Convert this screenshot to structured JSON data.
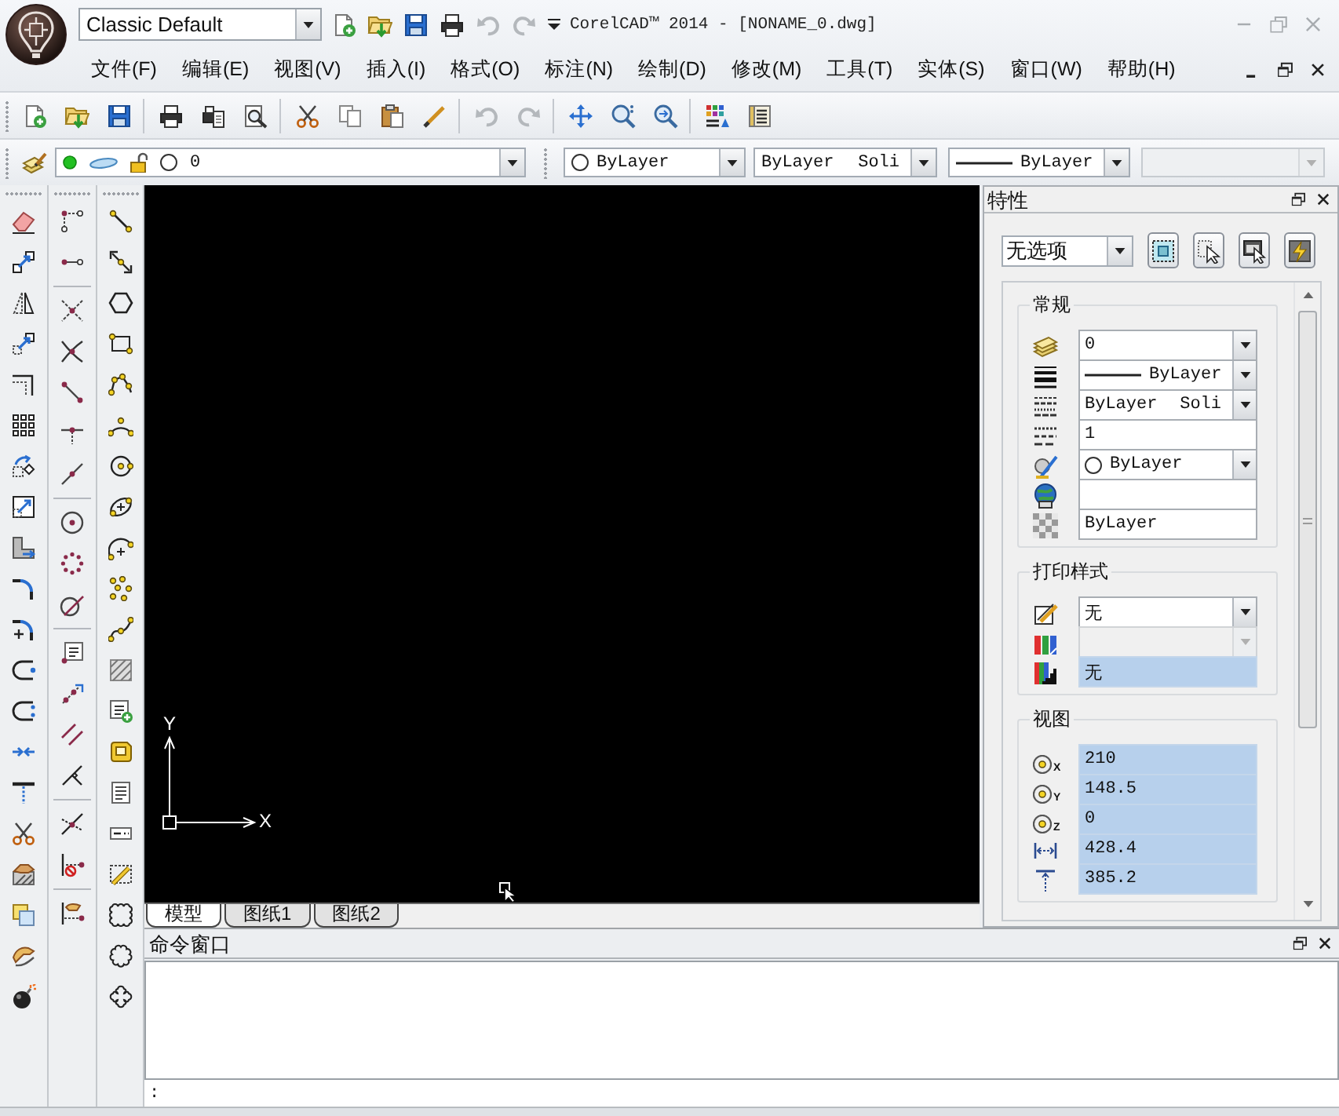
{
  "window": {
    "workspace": "Classic Default",
    "title": "CorelCAD™ 2014 - [NONAME_0.dwg]"
  },
  "quick_access": {
    "undo": {
      "disabled": true
    },
    "redo": {
      "disabled": true
    }
  },
  "menu": [
    "文件(F)",
    "编辑(E)",
    "视图(V)",
    "插入(I)",
    "格式(O)",
    "标注(N)",
    "绘制(D)",
    "修改(M)",
    "工具(T)",
    "实体(S)",
    "窗口(W)",
    "帮助(H)"
  ],
  "standard_toolbar": {
    "undo": {
      "disabled": true
    },
    "redo": {
      "disabled": true
    }
  },
  "layer_toolbar": {
    "layer": {
      "name": "0",
      "visible": true,
      "locked": false
    },
    "color_setting": "ByLayer",
    "linetype": {
      "name": "ByLayer",
      "description": "Soli"
    },
    "lineweight": "ByLayer",
    "plot_style": {
      "disabled": true
    }
  },
  "drawing": {
    "ucs": {
      "y_label": "Y",
      "x_label": "X"
    },
    "tabs": [
      {
        "label": "模型",
        "selected": true
      },
      {
        "label": "图纸1",
        "selected": false
      },
      {
        "label": "图纸2",
        "selected": false
      }
    ]
  },
  "properties": {
    "title": "特性",
    "selection": "无选项",
    "groups": [
      {
        "title": "常规",
        "rows": [
          {
            "kind": "dropdown",
            "value": "0",
            "disabled": false
          },
          {
            "kind": "lineweight",
            "value": "ByLayer",
            "disabled": false
          },
          {
            "kind": "linetype",
            "value": "ByLayer",
            "description": "Soli",
            "disabled": false
          },
          {
            "kind": "field",
            "value": "1",
            "disabled": false
          },
          {
            "kind": "color",
            "value": "ByLayer",
            "disabled": false
          },
          {
            "kind": "field",
            "disabled": false
          },
          {
            "kind": "field",
            "value": "ByLayer",
            "disabled": false
          }
        ]
      },
      {
        "title": "打印样式",
        "rows": [
          {
            "kind": "dropdown",
            "value": "无",
            "disabled": false
          },
          {
            "kind": "dropdown",
            "disabled": true
          },
          {
            "kind": "readonly",
            "value": "无",
            "disabled": false
          }
        ]
      },
      {
        "title": "视图",
        "rows": [
          {
            "kind": "readonly",
            "icon_label": "X",
            "value": "210",
            "disabled": false
          },
          {
            "kind": "readonly",
            "icon_label": "Y",
            "value": "148.5",
            "disabled": false
          },
          {
            "kind": "readonly",
            "icon_label": "Z",
            "value": "0",
            "disabled": false
          },
          {
            "kind": "readonly",
            "value": "428.4",
            "disabled": false
          },
          {
            "kind": "readonly",
            "value": "385.2",
            "disabled": false
          }
        ]
      }
    ]
  },
  "command_window": {
    "title": "命令窗口",
    "prompt": ":"
  }
}
